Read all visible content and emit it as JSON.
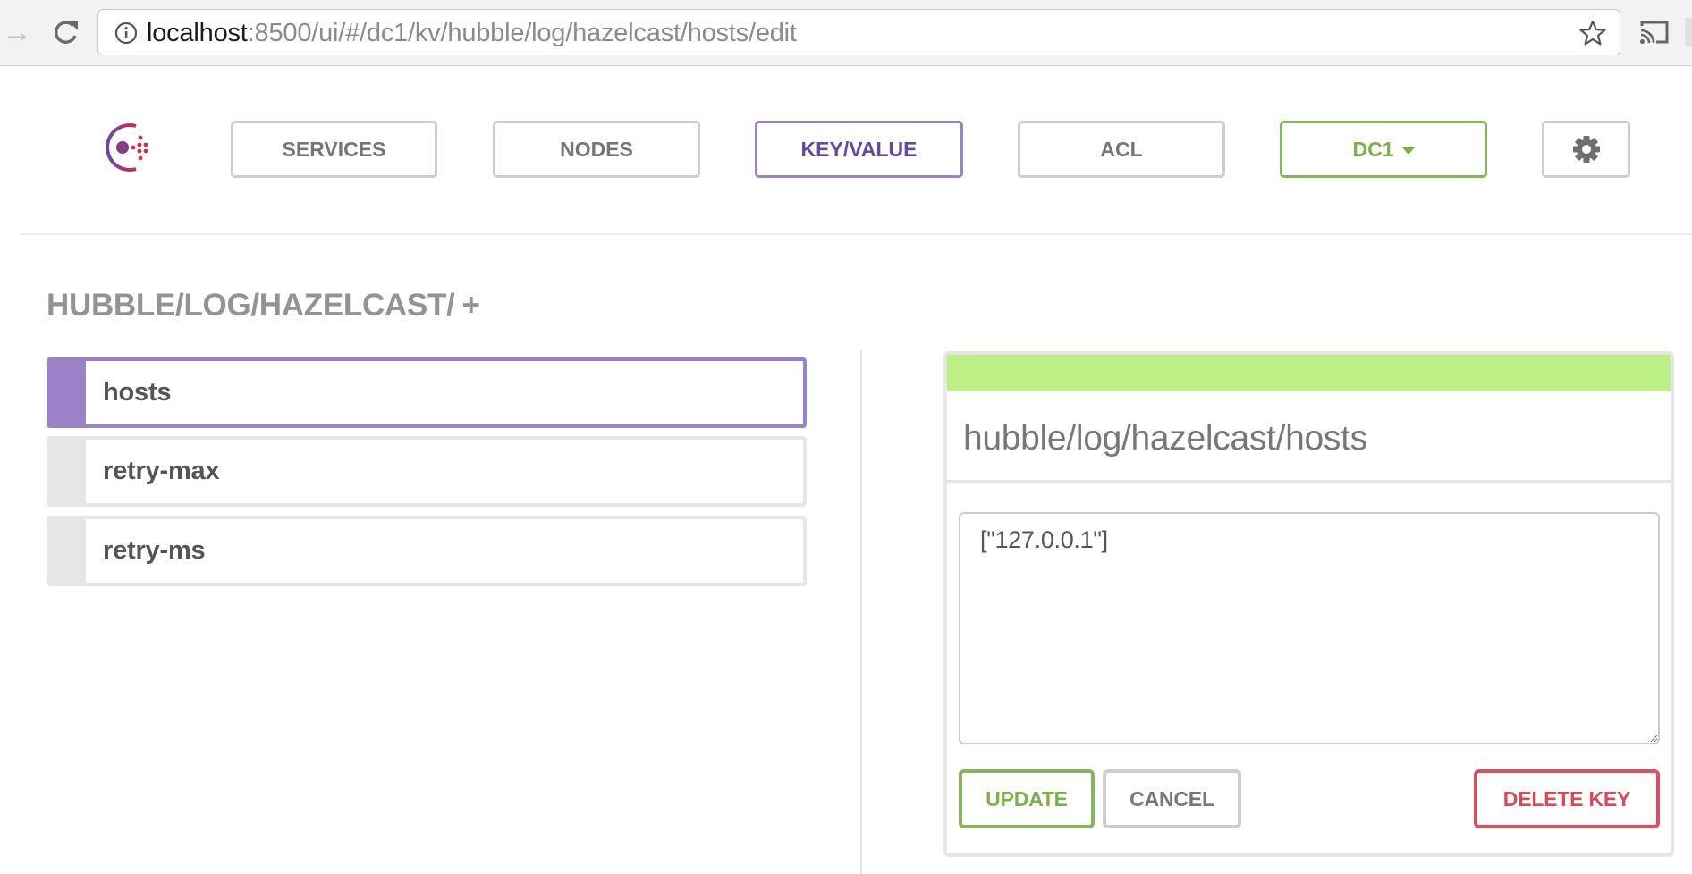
{
  "browser": {
    "url_host": "localhost",
    "url_rest": ":8500/ui/#/dc1/kv/hubble/log/hazelcast/hosts/edit",
    "icons": [
      "forward-icon",
      "reload-icon",
      "info-icon",
      "bookmark-star-icon",
      "cast-icon"
    ]
  },
  "nav": {
    "items": [
      {
        "label": "SERVICES"
      },
      {
        "label": "NODES"
      },
      {
        "label": "KEY/VALUE",
        "active": true
      },
      {
        "label": "ACL"
      }
    ],
    "datacenter": "DC1",
    "settings_icon": "gear-icon"
  },
  "kv": {
    "path_heading": "HUBBLE/LOG/HAZELCAST/",
    "add_label": "+",
    "keys": [
      {
        "label": "hosts",
        "active": true
      },
      {
        "label": "retry-max"
      },
      {
        "label": "retry-ms"
      }
    ]
  },
  "editor": {
    "key_path": "hubble/log/hazelcast/hosts",
    "value": "[\"127.0.0.1\"]",
    "update_label": "UPDATE",
    "cancel_label": "CANCEL",
    "delete_label": "DELETE KEY"
  },
  "colors": {
    "accent_purple": "#9b82c6",
    "accent_green": "#86b659",
    "status_band": "#bcf087",
    "danger_red": "#de4e5c"
  }
}
